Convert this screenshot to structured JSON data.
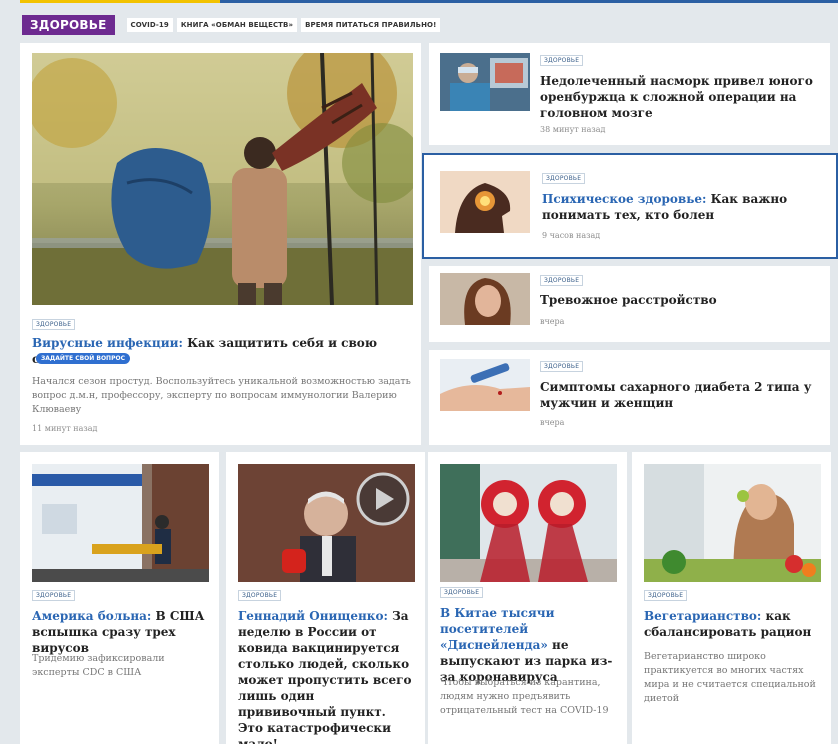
{
  "header": {
    "section": "ЗДОРОВЬЕ",
    "tags": [
      "COVID-19",
      "КНИГА «ОБМАН ВЕЩЕСТВ»",
      "ВРЕМЯ ПИТАТЬСЯ ПРАВИЛЬНО!"
    ]
  },
  "main": {
    "rubric": "ЗДОРОВЬЕ",
    "title_highlight": "Вирусные инфекции:",
    "title_rest": " Как защитить себя и свою семью",
    "badge": "ЗАДАЙТЕ СВОЙ ВОПРОС",
    "lead": "Начался сезон простуд. Воспользуйтесь уникальной возможностью задать вопрос д.м.н, профессору, эксперту по вопросам иммунологии Валерию Клюваеву",
    "time": "11 минут назад"
  },
  "side": [
    {
      "rubric": "ЗДОРОВЬЕ",
      "highlight": "",
      "title": "Недолеченный насморк привел юного оренбуржца к сложной операции на головном мозге",
      "time": "38 минут назад"
    },
    {
      "rubric": "ЗДОРОВЬЕ",
      "highlight": "Психическое здоровье:",
      "title": " Как важно понимать тех, кто болен",
      "time": "9 часов назад"
    },
    {
      "rubric": "ЗДОРОВЬЕ",
      "highlight": "",
      "title": "Тревожное расстройство",
      "time": "вчера"
    },
    {
      "rubric": "ЗДОРОВЬЕ",
      "highlight": "",
      "title": "Симптомы сахарного диабета 2 типа у мужчин и женщин",
      "time": "вчера"
    }
  ],
  "bottom": [
    {
      "rubric": "ЗДОРОВЬЕ",
      "highlight": "Америка больна:",
      "title": " В США вспышка сразу трех вирусов",
      "lead": "Тридемию зафиксировали эксперты CDC в США"
    },
    {
      "rubric": "ЗДОРОВЬЕ",
      "highlight": "Геннадий Онищенко:",
      "title": " За неделю в России от ковида вакцинируется столько людей, сколько может пропустить всего лишь один прививочный пункт. Это катастрофически мало!",
      "lead": ""
    },
    {
      "rubric": "ЗДОРОВЬЕ",
      "highlight": "В Китае тысячи посетителей «Диснейленда»",
      "title": " не выпускают из парка из-за коронавируса",
      "lead": "Чтобы выбраться из карантина, людям нужно предъявить отрицательный тест на COVID-19"
    },
    {
      "rubric": "ЗДОРОВЬЕ",
      "highlight": "Вегетарианство:",
      "title": " как сбалансировать рацион",
      "lead": "Вегетарианство широко практикуется во многих частях мира и не считается специальной диетой"
    }
  ],
  "colors": {
    "section": "#6d2a90",
    "link": "#2a66b3",
    "badge": "#2f6fd0",
    "focus": "#2b5fa3"
  }
}
